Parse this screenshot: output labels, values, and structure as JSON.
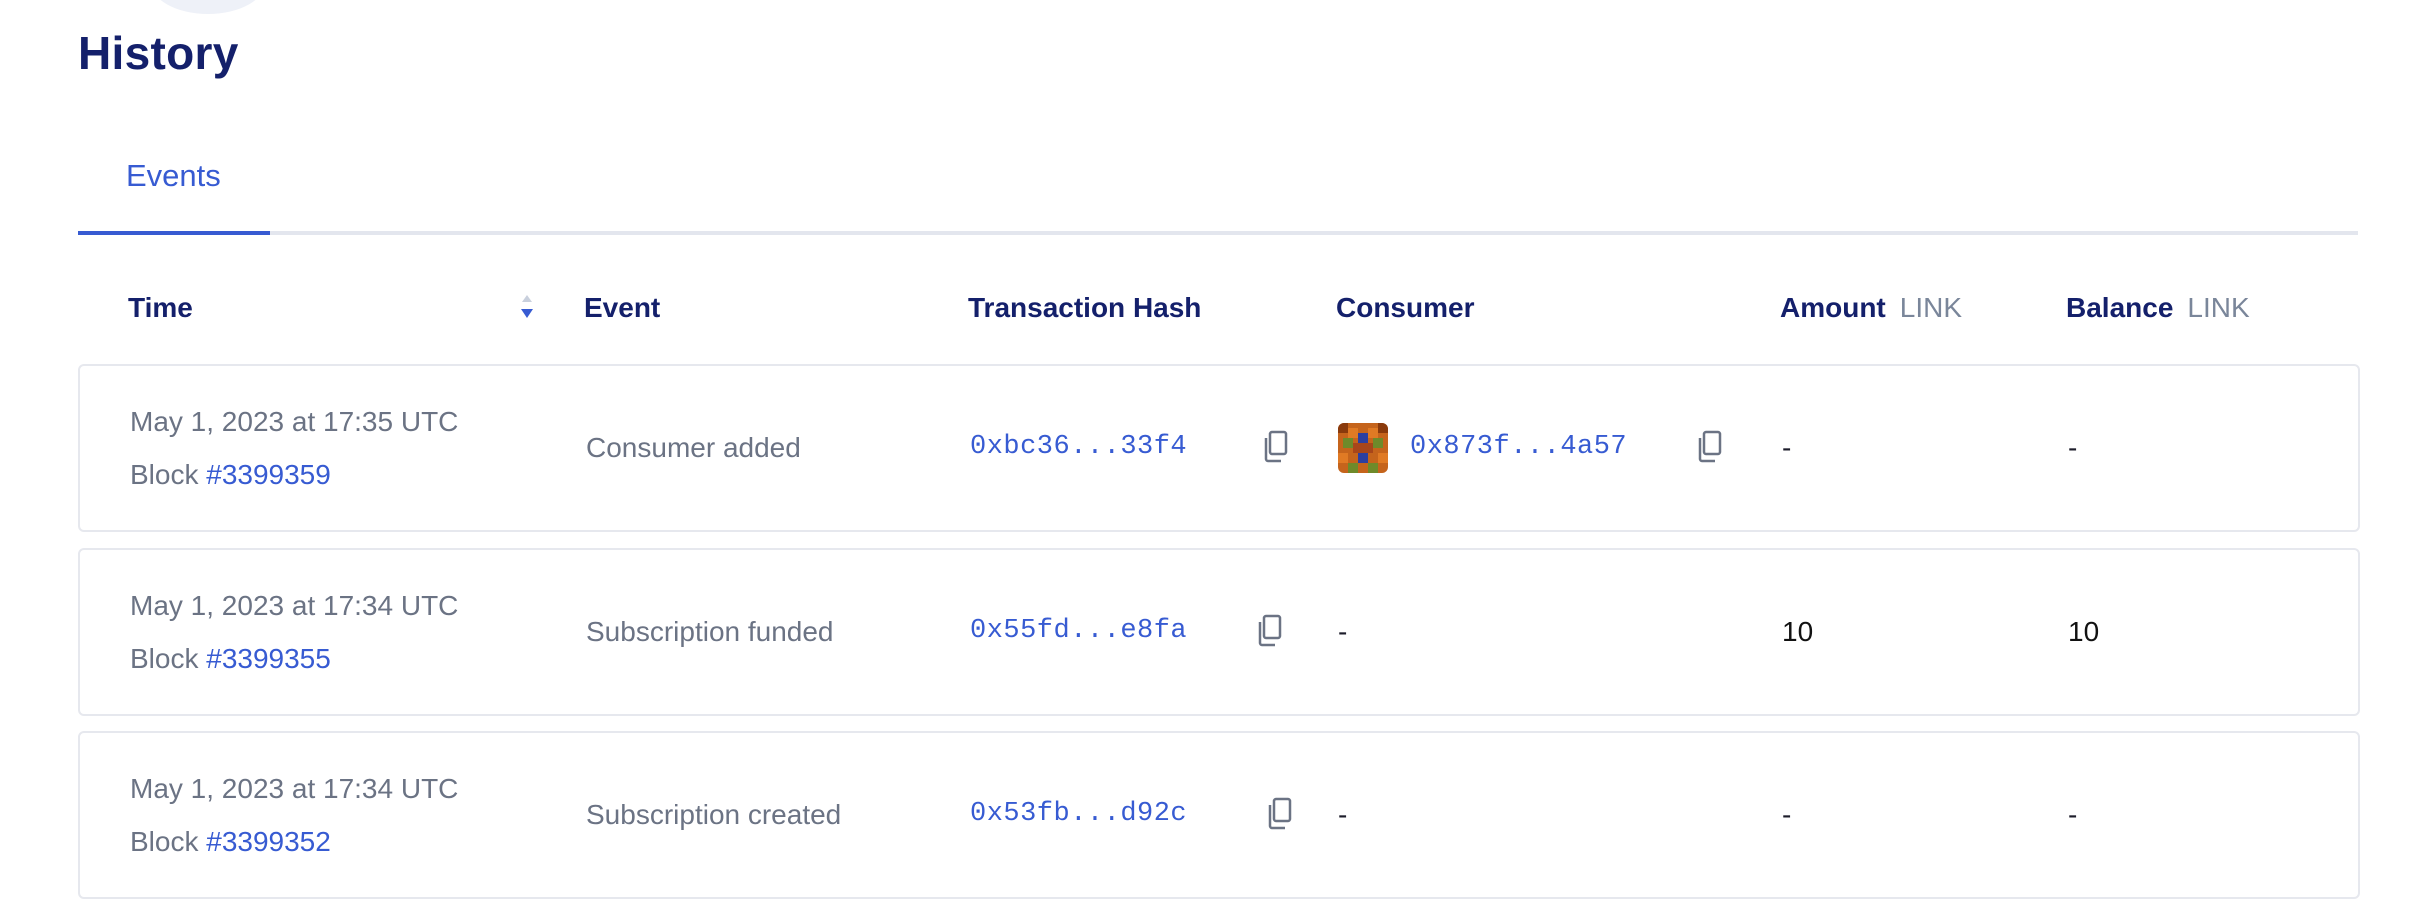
{
  "page": {
    "title": "History"
  },
  "tabs": [
    {
      "label": "Events",
      "active": true
    }
  ],
  "table": {
    "columns": {
      "time": "Time",
      "event": "Event",
      "hash": "Transaction Hash",
      "consumer": "Consumer",
      "amount": "Amount",
      "amount_unit": "LINK",
      "balance": "Balance",
      "balance_unit": "LINK"
    },
    "rows": [
      {
        "time": "May 1, 2023 at 17:35 UTC",
        "block_prefix": "Block",
        "block": "#3399359",
        "event": "Consumer added",
        "hash": "0xbc36...33f4",
        "consumer": "0x873f...4a57",
        "amount": "-",
        "balance": "-"
      },
      {
        "time": "May 1, 2023 at 17:34 UTC",
        "block_prefix": "Block",
        "block": "#3399355",
        "event": "Subscription funded",
        "hash": "0x55fd...e8fa",
        "consumer": "-",
        "amount": "10",
        "balance": "10"
      },
      {
        "time": "May 1, 2023 at 17:34 UTC",
        "block_prefix": "Block",
        "block": "#3399352",
        "event": "Subscription created",
        "hash": "0x53fb...d92c",
        "consumer": "-",
        "amount": "-",
        "balance": "-"
      }
    ]
  },
  "colors": {
    "accent": "#375bd2",
    "heading": "#14206b",
    "muted": "#6b7384",
    "border": "#e6e8ee"
  },
  "icons": {
    "copy": "copy-icon",
    "sort": "sort-desc-icon",
    "avatar": "identicon-avatar"
  }
}
